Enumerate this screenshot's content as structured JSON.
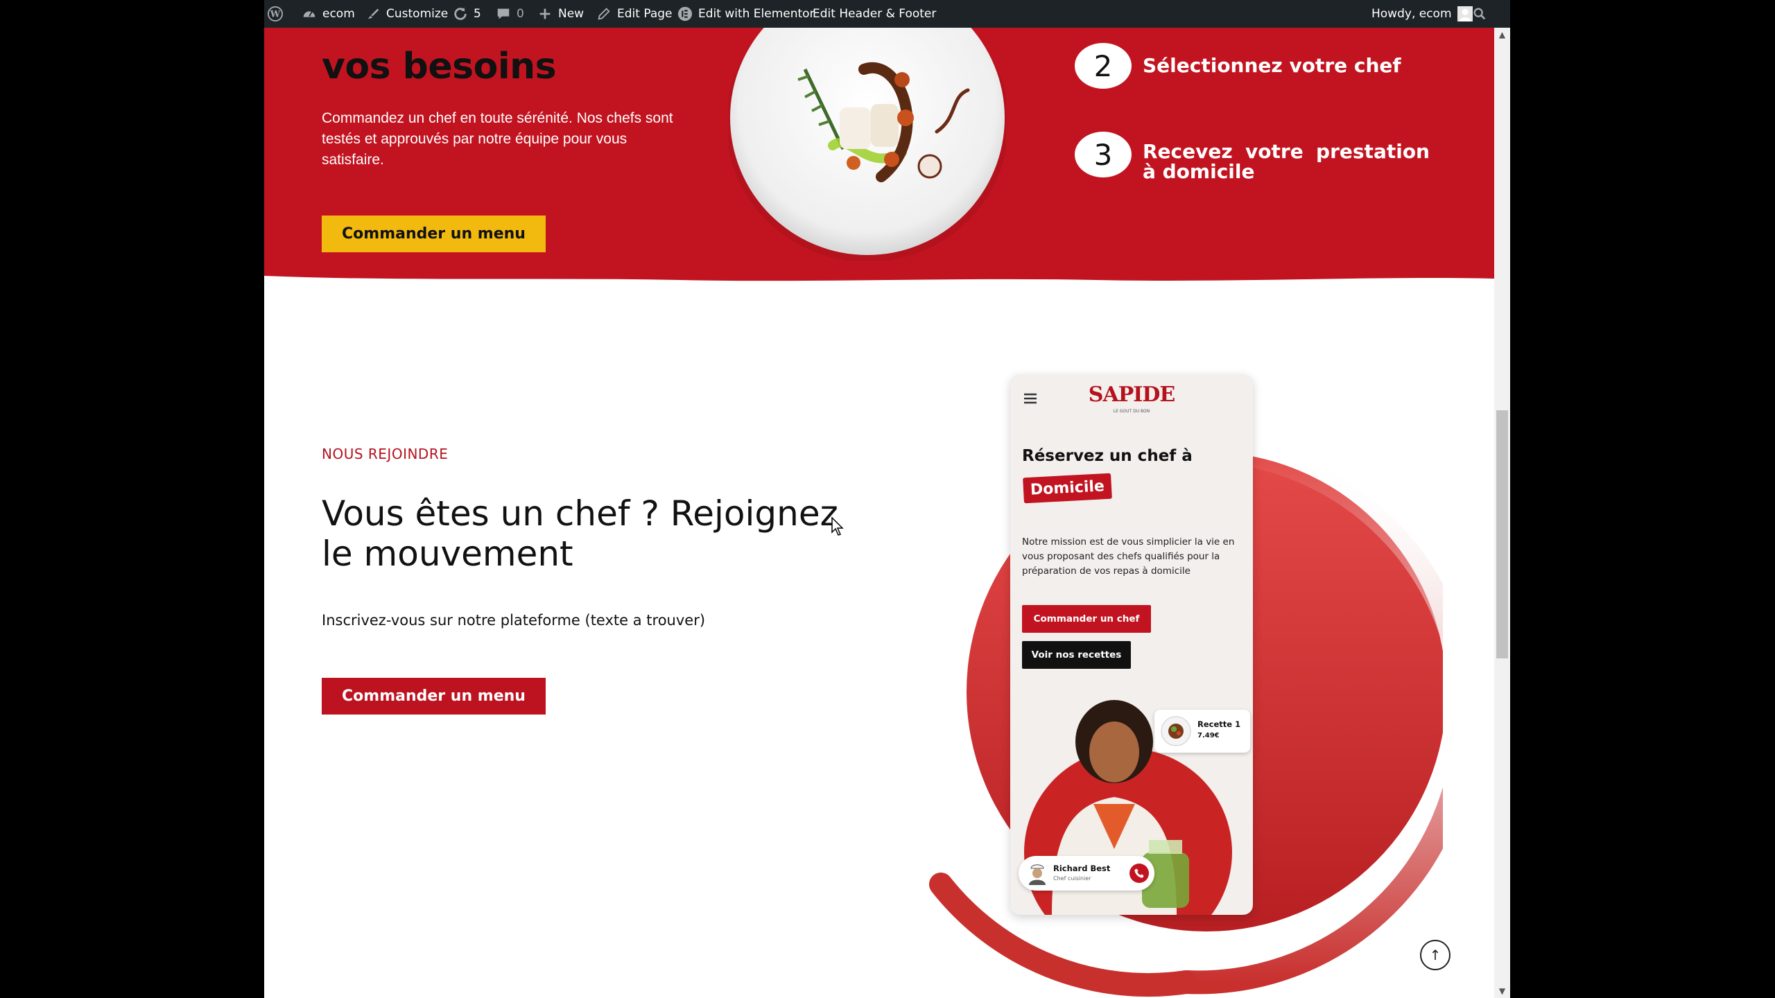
{
  "adminbar": {
    "site_name": "ecom",
    "customize": "Customize",
    "updates_count": "5",
    "comments_count": "0",
    "new_label": "New",
    "edit_page": "Edit Page",
    "edit_elementor": "Edit with Elementor",
    "edit_header_footer": "Edit Header & Footer",
    "howdy": "Howdy, ecom"
  },
  "hero": {
    "title": "vos besoins",
    "description": "Commandez un chef en toute sérénité. Nos chefs sont testés et approuvés par notre équipe pour vous satisfaire.",
    "button_label": "Commander un menu",
    "steps": [
      {
        "number": "2",
        "text": "Sélectionnez votre chef"
      },
      {
        "number": "3",
        "text": "Recevez votre prestation à domicile"
      }
    ]
  },
  "join": {
    "eyebrow": "NOUS REJOINDRE",
    "title": "Vous êtes un chef ? Rejoignez le mouvement",
    "subtitle": "Inscrivez-vous sur notre plateforme (texte a trouver)",
    "button_label": "Commander un menu"
  },
  "phone": {
    "logo": "SAPIDE",
    "logo_tagline": "LE GOUT DU BON",
    "headline": "Réservez un chef à",
    "badge": "Domicile",
    "mission": "Notre mission est de vous simplicier la vie en vous proposant des chefs qualifiés pour la préparation de vos repas à domicile",
    "btn_primary": "Commander un chef",
    "btn_secondary": "Voir nos recettes",
    "recipe_name": "Recette 1",
    "recipe_price": "7.49€",
    "chef_name": "Richard Best",
    "chef_role": "Chef cuisinier"
  },
  "colors": {
    "brand_red": "#c21420",
    "accent_yellow": "#f2b90f",
    "adminbar_bg": "#1d2327"
  },
  "icons": {
    "wordpress": "wordpress-icon",
    "dashboard": "dashboard-icon",
    "brush": "brush-icon",
    "updates": "refresh-icon",
    "comments": "comment-icon",
    "plus": "plus-icon",
    "pencil": "pencil-icon",
    "elementor": "elementor-icon",
    "search": "search-icon",
    "avatar": "avatar-icon",
    "back_to_top": "arrow-up-icon"
  }
}
